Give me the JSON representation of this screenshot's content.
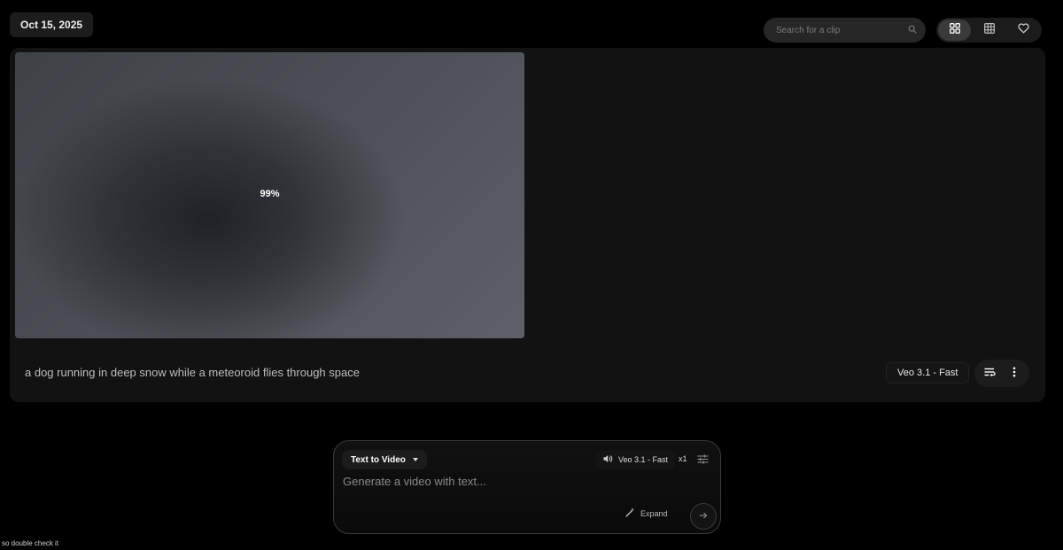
{
  "header": {
    "date": "Oct 15, 2025",
    "search_placeholder": "Search for a clip",
    "view_options": [
      "grid-large",
      "grid-small",
      "favorites"
    ]
  },
  "clip": {
    "progress": "99%",
    "prompt": "a dog running in deep snow while a meteoroid flies through space",
    "model": "Veo 3.1 - Fast"
  },
  "composer": {
    "mode": "Text to Video",
    "model": "Veo 3.1 - Fast",
    "count": "x1",
    "placeholder": "Generate a video with text...",
    "expand_label": "Expand"
  },
  "footnote": "so double check it",
  "colors": {
    "background": "#000000",
    "card": "#121212",
    "accent": "#3a3a3a"
  }
}
